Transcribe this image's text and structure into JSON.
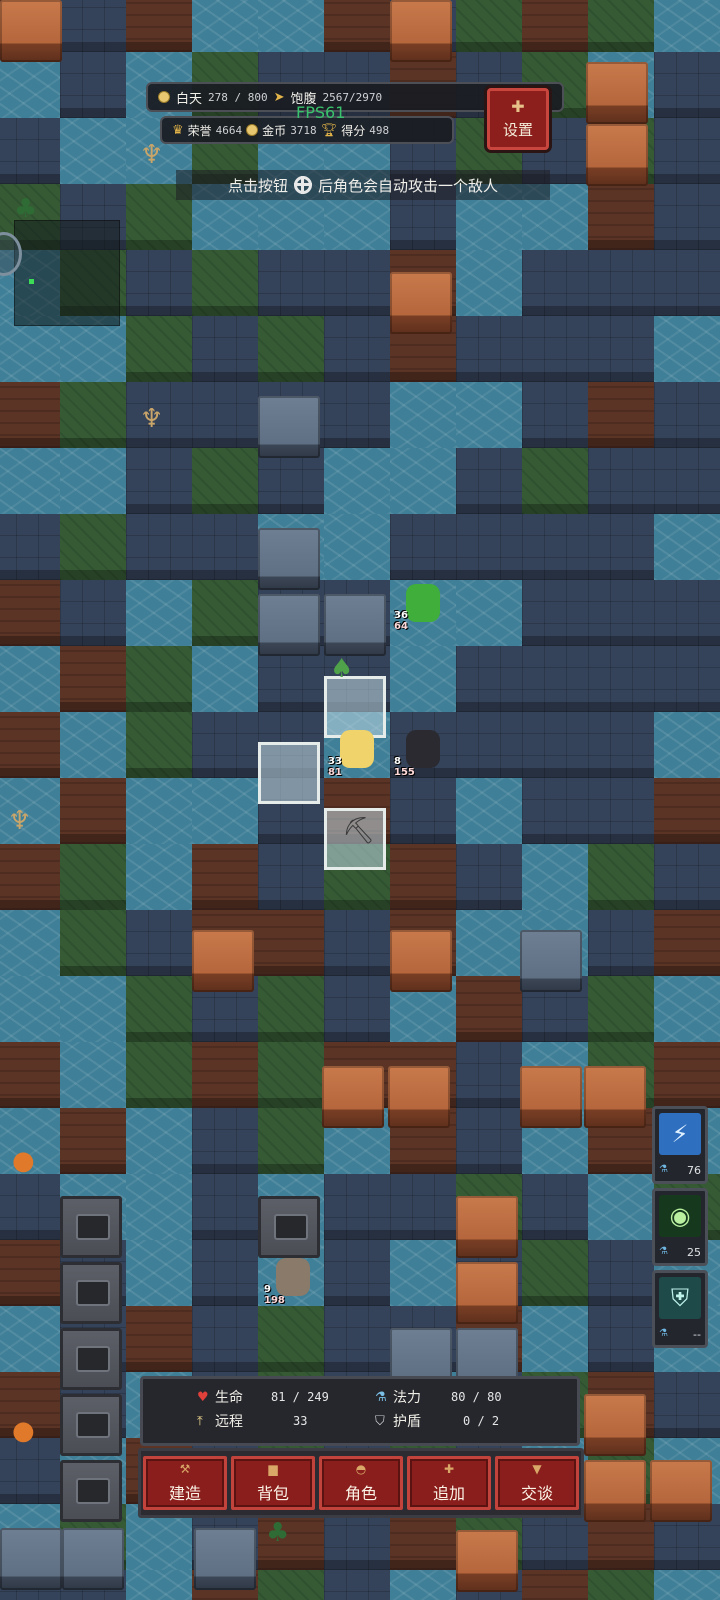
{
  "hud": {
    "day_label": "白天",
    "day_value": "278 / 800",
    "satiety_label": "饱腹",
    "satiety_value": "2567/2970",
    "honor_label": "荣誉",
    "honor_value": "4664",
    "coins_label": "金币",
    "coins_value": "3718",
    "score_label": "得分",
    "score_value": "498",
    "fps": "FPS61",
    "settings_label": "设置"
  },
  "hint": {
    "before": "点击按钮",
    "after": "后角色会自动攻击一个敌人"
  },
  "characters": [
    {
      "name": "green-haired-archer",
      "stat_top": "36",
      "stat_bottom": "64"
    },
    {
      "name": "blonde-knight",
      "stat_top": "33",
      "stat_bottom": "81"
    },
    {
      "name": "dark-haired-ally",
      "stat_top": "8",
      "stat_bottom": "155"
    },
    {
      "name": "crystal-enemy",
      "stat_top": "9",
      "stat_bottom": "198"
    }
  ],
  "skills": [
    {
      "icon": "lightning-icon",
      "cost": "76"
    },
    {
      "icon": "eye-icon",
      "cost": "25"
    },
    {
      "icon": "shield-icon",
      "cost": "--"
    }
  ],
  "stats": {
    "hp_label": "生命",
    "hp_value": "81 / 249",
    "mana_label": "法力",
    "mana_value": "80 / 80",
    "ranged_label": "远程",
    "ranged_value": "33",
    "shield_label": "护盾",
    "shield_value": "0 / 2"
  },
  "actions": [
    {
      "label": "建造"
    },
    {
      "label": "背包"
    },
    {
      "label": "角色"
    },
    {
      "label": "追加"
    },
    {
      "label": "交谈"
    }
  ]
}
